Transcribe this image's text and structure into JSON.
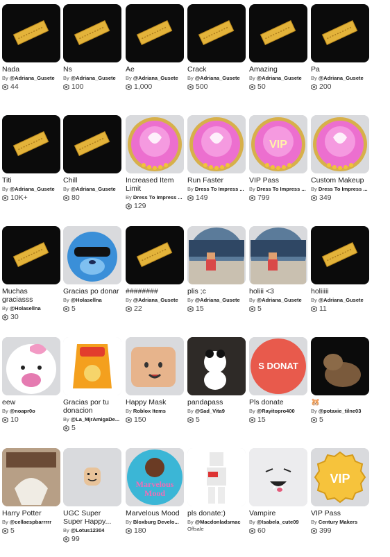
{
  "items": [
    {
      "name": "Nada",
      "creator": "@Adriana_Gusete",
      "price": "44",
      "thumb": "ticket"
    },
    {
      "name": "Ns",
      "creator": "@Adriana_Gusete",
      "price": "100",
      "thumb": "ticket"
    },
    {
      "name": "Ae",
      "creator": "@Adriana_Gusete",
      "price": "1,000",
      "thumb": "ticket"
    },
    {
      "name": "Crack",
      "creator": "@Adriana_Gusete",
      "price": "500",
      "thumb": "ticket"
    },
    {
      "name": "Amazing",
      "creator": "@Adriana_Gusete",
      "price": "50",
      "thumb": "ticket"
    },
    {
      "name": "Pa",
      "creator": "@Adriana_Gusete",
      "price": "200",
      "thumb": "ticket"
    },
    {
      "name": "Titi",
      "creator": "@Adriana_Gusete",
      "price": "10K+",
      "thumb": "ticket"
    },
    {
      "name": "Chill",
      "creator": "@Adriana_Gusete",
      "price": "80",
      "thumb": "ticket"
    },
    {
      "name": "Increased Item Limit",
      "creator": "Dress To Impress ...",
      "price": "129",
      "thumb": "pink-badge"
    },
    {
      "name": "Run Faster",
      "creator": "Dress To Impress ...",
      "price": "149",
      "thumb": "pink-badge"
    },
    {
      "name": "VIP Pass",
      "creator": "Dress To Impress ...",
      "price": "799",
      "thumb": "pink-badge-vip"
    },
    {
      "name": "Custom Makeup",
      "creator": "Dress To Impress ...",
      "price": "349",
      "thumb": "pink-badge"
    },
    {
      "name": "Muchas graciasss",
      "creator": "@Holasellna",
      "price": "30",
      "thumb": "ticket"
    },
    {
      "name": "Gracias po donar",
      "creator": "@Holasellna",
      "price": "5",
      "thumb": "blue-creature"
    },
    {
      "name": "########",
      "creator": "@Adriana_Gusete",
      "price": "22",
      "thumb": "ticket"
    },
    {
      "name": "plis ;c",
      "creator": "@Adriana_Gusete",
      "price": "15",
      "thumb": "room"
    },
    {
      "name": "holiii <3",
      "creator": "@Adriana_Gusete",
      "price": "5",
      "thumb": "room"
    },
    {
      "name": "holiiiii",
      "creator": "@Adriana_Gusete",
      "price": "11",
      "thumb": "ticket"
    },
    {
      "name": "eew",
      "creator": "@noapr0o",
      "price": "10",
      "thumb": "kitty"
    },
    {
      "name": "Gracias por tu donacion",
      "creator": "@La_MjrAmigaDe...",
      "price": "5",
      "thumb": "cheetos"
    },
    {
      "name": "Happy Mask",
      "creator": "Roblox Items",
      "price": "150",
      "thumb": "mask"
    },
    {
      "name": "pandapass",
      "creator": "@Sad_Vita9",
      "price": "5",
      "thumb": "panda"
    },
    {
      "name": "Pls donate",
      "creator": "@Rayitopro400",
      "price": "15",
      "thumb": "donate"
    },
    {
      "name": "🐹",
      "creator": "@potaxie_tilne03",
      "price": "5",
      "thumb": "capybara"
    },
    {
      "name": "Harry Potter",
      "creator": "@cellaespbarrrrr",
      "price": "5",
      "thumb": "potter"
    },
    {
      "name": "UGC Super Super Happy...",
      "creator": "@Lotus12304",
      "price": "99",
      "thumb": "ugc-head"
    },
    {
      "name": "Marvelous Mood",
      "creator": "Bloxburg Develo...",
      "price": "180",
      "thumb": "marvelous"
    },
    {
      "name": "pls donate:)",
      "creator": "@Macdonladsmac",
      "status": "Offsale",
      "price": "",
      "thumb": "avatar"
    },
    {
      "name": "Vampire",
      "creator": "@Isabela_cute09",
      "price": "60",
      "thumb": "vampire"
    },
    {
      "name": "VIP Pass",
      "creator": "Century Makers",
      "price": "399",
      "thumb": "vip-gold"
    }
  ],
  "by_label": "By",
  "marvelous_text": "Marvelous Mood",
  "donate_text": "S DONAT",
  "vip_text": "VIP",
  "colors": {
    "text": "#1b1b1b",
    "tile_bg": "#d9dadd",
    "ticket_gold": "#e3b33a",
    "pink": "#e85fc8"
  }
}
